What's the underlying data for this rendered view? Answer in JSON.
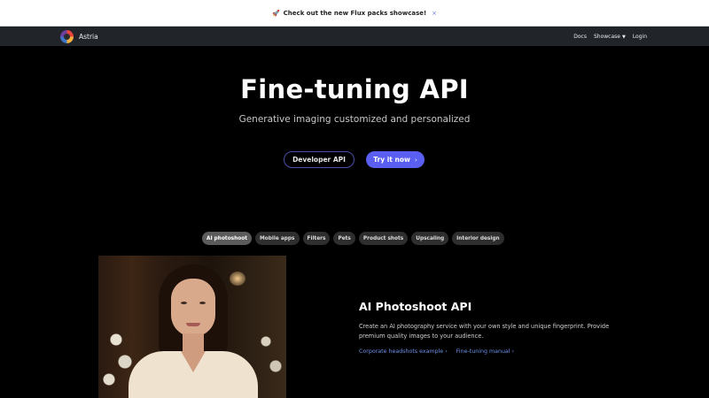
{
  "banner": {
    "icon": "rocket-icon",
    "text": "Check out the new Flux packs showcase!",
    "close": "×"
  },
  "navbar": {
    "brand": "Astria",
    "links": [
      {
        "label": "Docs"
      },
      {
        "label": "Showcase"
      },
      {
        "label": "Login"
      }
    ]
  },
  "hero": {
    "title": "Fine-tuning API",
    "subtitle": "Generative imaging customized and personalized",
    "developer_button": "Developer API",
    "try_button": "Try it now"
  },
  "tabs": [
    {
      "label": "AI photoshoot",
      "active": true
    },
    {
      "label": "Mobile apps",
      "active": false
    },
    {
      "label": "Filters",
      "active": false
    },
    {
      "label": "Pets",
      "active": false
    },
    {
      "label": "Product shots",
      "active": false
    },
    {
      "label": "Upscaling",
      "active": false
    },
    {
      "label": "Interior design",
      "active": false
    }
  ],
  "feature": {
    "title": "AI Photoshoot API",
    "description": "Create an AI photography service with your own style and unique fingerprint. Provide premium quality images to your audience.",
    "links": [
      {
        "label": "Corporate headshots example"
      },
      {
        "label": "Fine-tuning manual"
      }
    ]
  },
  "colors": {
    "accent": "#5a5ff2",
    "link": "#6c8fe8",
    "navbar": "#212529",
    "background": "#000000"
  }
}
